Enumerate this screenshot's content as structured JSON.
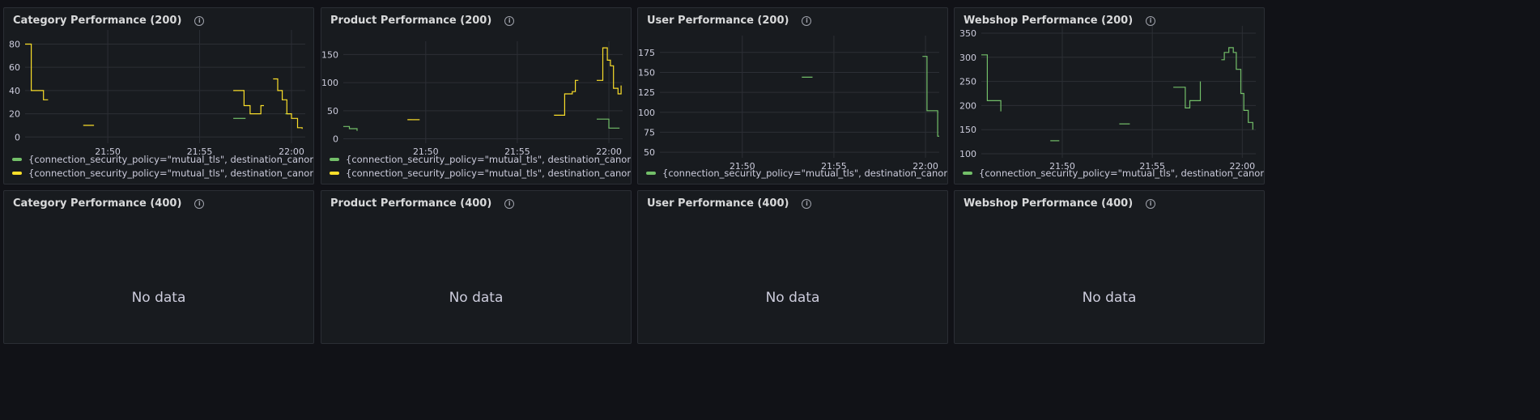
{
  "colors": {
    "green": "#73bf69",
    "yellow": "#fade2a",
    "grid": "#2c2f35",
    "axis": "#ccccdc"
  },
  "info_icon": "info-circle-icon",
  "legend_label": "{connection_security_policy=\"mutual_tls\", destination_canonical_revision=\"latest\", destination_service=\"webshop-category-svc.ms-webshop.svc.cluster.local\"}",
  "no_data_text": "No data",
  "panels_top": [
    {
      "title": "Category Performance (200)"
    },
    {
      "title": "Product Performance (200)"
    },
    {
      "title": "User Performance (200)"
    },
    {
      "title": "Webshop Performance (200)"
    }
  ],
  "panels_bottom": [
    {
      "title": "Category Performance (400)"
    },
    {
      "title": "Product Performance (400)"
    },
    {
      "title": "User Performance (400)"
    },
    {
      "title": "Webshop Performance (400)"
    }
  ],
  "chart_data": [
    {
      "type": "line",
      "title": "Category Performance (200)",
      "x_ticks": [
        "21:50",
        "21:55",
        "22:00"
      ],
      "xlim": [
        "21:45:30",
        "22:00:45"
      ],
      "y_ticks": [
        0,
        20,
        40,
        60,
        80
      ],
      "ylim": [
        -4,
        88
      ],
      "legend": "bottom",
      "series": [
        {
          "color": "#73bf69",
          "segments": [
            [
              [
                "21:56:50",
                16
              ],
              [
                "21:57:30",
                16
              ]
            ],
            [
              [
                "21:59:40",
                20
              ],
              [
                "21:59:55",
                20
              ]
            ]
          ]
        },
        {
          "color": "#fade2a",
          "segments": [
            [
              [
                "21:45:30",
                80
              ],
              [
                "21:45:45",
                80
              ],
              [
                "21:45:50",
                40
              ],
              [
                "21:46:20",
                40
              ],
              [
                "21:46:30",
                32
              ],
              [
                "21:46:45",
                32
              ]
            ],
            [
              [
                "21:48:40",
                10
              ],
              [
                "21:49:15",
                10
              ]
            ],
            [
              [
                "21:56:50",
                40
              ],
              [
                "21:57:15",
                40
              ],
              [
                "21:57:25",
                27
              ],
              [
                "21:57:45",
                20
              ],
              [
                "21:58:05",
                20
              ],
              [
                "21:58:20",
                27
              ],
              [
                "21:58:30",
                27
              ]
            ],
            [
              [
                "21:59:00",
                50
              ],
              [
                "21:59:15",
                40
              ],
              [
                "21:59:30",
                32
              ],
              [
                "21:59:45",
                20
              ],
              [
                "22:00:00",
                16
              ],
              [
                "22:00:20",
                8
              ],
              [
                "22:00:35",
                7
              ]
            ]
          ]
        }
      ]
    },
    {
      "type": "line",
      "title": "Product Performance (200)",
      "x_ticks": [
        "21:50",
        "21:55",
        "22:00"
      ],
      "xlim": [
        "21:45:30",
        "22:00:45"
      ],
      "y_ticks": [
        0,
        50,
        100,
        150
      ],
      "ylim": [
        -5,
        165
      ],
      "legend": "bottom",
      "series": [
        {
          "color": "#73bf69",
          "segments": [
            [
              [
                "21:45:30",
                22
              ],
              [
                "21:45:50",
                18
              ],
              [
                "21:46:15",
                14
              ]
            ],
            [
              [
                "21:59:20",
                35
              ],
              [
                "21:59:50",
                35
              ],
              [
                "22:00:00",
                19
              ],
              [
                "22:00:35",
                19
              ]
            ]
          ]
        },
        {
          "color": "#fade2a",
          "segments": [
            [
              [
                "21:49:00",
                34
              ],
              [
                "21:49:40",
                34
              ]
            ],
            [
              [
                "21:57:00",
                42
              ],
              [
                "21:57:20",
                42
              ],
              [
                "21:57:35",
                80
              ],
              [
                "21:58:00",
                84
              ],
              [
                "21:58:10",
                104
              ],
              [
                "21:58:20",
                104
              ]
            ],
            [
              [
                "21:59:20",
                104
              ],
              [
                "21:59:35",
                104
              ],
              [
                "21:59:40",
                162
              ],
              [
                "21:59:55",
                140
              ],
              [
                "22:00:05",
                130
              ],
              [
                "22:00:15",
                90
              ],
              [
                "22:00:30",
                80
              ],
              [
                "22:00:40",
                95
              ]
            ]
          ]
        }
      ]
    },
    {
      "type": "line",
      "title": "User Performance (200)",
      "x_ticks": [
        "21:50",
        "21:55",
        "22:00"
      ],
      "xlim": [
        "21:45:30",
        "22:00:45"
      ],
      "y_ticks": [
        50,
        75,
        100,
        125,
        150,
        175
      ],
      "ylim": [
        45,
        190
      ],
      "legend": "bottom",
      "series": [
        {
          "color": "#73bf69",
          "segments": [
            [
              [
                "21:53:15",
                144
              ],
              [
                "21:53:50",
                144
              ]
            ],
            [
              [
                "21:59:50",
                170
              ],
              [
                "22:00:05",
                102
              ],
              [
                "22:00:30",
                102
              ],
              [
                "22:00:40",
                70
              ],
              [
                "22:00:45",
                70
              ]
            ]
          ]
        }
      ]
    },
    {
      "type": "line",
      "title": "Webshop Performance (200)",
      "x_ticks": [
        "21:50",
        "21:55",
        "22:00"
      ],
      "xlim": [
        "21:45:30",
        "22:00:45"
      ],
      "y_ticks": [
        100,
        150,
        200,
        250,
        300,
        350
      ],
      "ylim": [
        95,
        355
      ],
      "legend": "bottom",
      "series": [
        {
          "color": "#73bf69",
          "segments": [
            [
              [
                "21:45:30",
                305
              ],
              [
                "21:45:50",
                210
              ],
              [
                "21:46:20",
                210
              ],
              [
                "21:46:35",
                188
              ]
            ],
            [
              [
                "21:49:20",
                127
              ],
              [
                "21:49:50",
                127
              ]
            ],
            [
              [
                "21:53:10",
                162
              ],
              [
                "21:53:45",
                162
              ]
            ],
            [
              [
                "21:56:10",
                238
              ],
              [
                "21:56:40",
                238
              ],
              [
                "21:56:50",
                195
              ],
              [
                "21:57:05",
                210
              ],
              [
                "21:57:25",
                210
              ],
              [
                "21:57:40",
                250
              ]
            ],
            [
              [
                "21:58:50",
                295
              ],
              [
                "21:59:00",
                310
              ],
              [
                "21:59:15",
                320
              ],
              [
                "21:59:30",
                310
              ],
              [
                "21:59:40",
                275
              ],
              [
                "21:59:55",
                225
              ],
              [
                "22:00:05",
                190
              ],
              [
                "22:00:20",
                165
              ],
              [
                "22:00:35",
                150
              ]
            ]
          ]
        }
      ]
    }
  ]
}
